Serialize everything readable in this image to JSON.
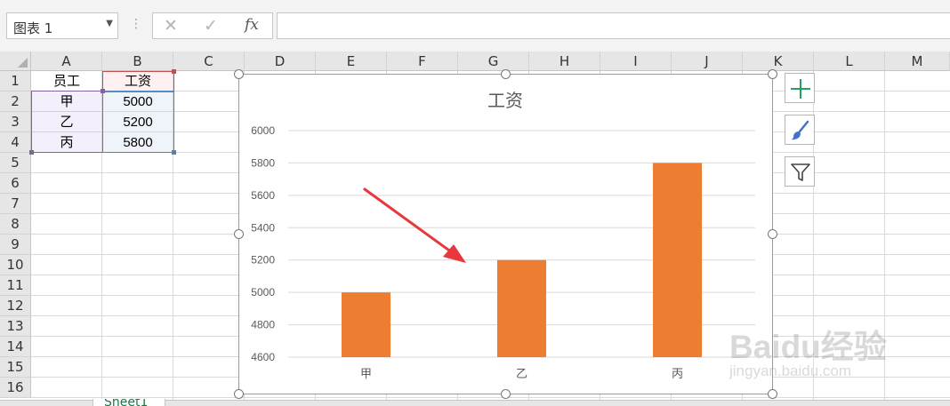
{
  "formula_bar": {
    "name_box": "图表 1",
    "cancel_icon": "✕",
    "enter_icon": "✓",
    "fx_label": "fx",
    "formula": ""
  },
  "columns": [
    "A",
    "B",
    "C",
    "D",
    "E",
    "F",
    "G",
    "H",
    "I",
    "J",
    "K",
    "L",
    "M"
  ],
  "rows": [
    "1",
    "2",
    "3",
    "4",
    "5",
    "6",
    "7",
    "8",
    "9",
    "10",
    "11",
    "12",
    "13",
    "14",
    "15",
    "16"
  ],
  "cells": {
    "A1": "员工",
    "B1": "工资",
    "A2": "甲",
    "B2": "5000",
    "A3": "乙",
    "B3": "5200",
    "A4": "丙",
    "B4": "5800"
  },
  "colors": {
    "accent": "#217346",
    "bar": "#ED7D31",
    "arrow": "#E8373D"
  },
  "chart_data": {
    "type": "bar",
    "title": "工资",
    "categories": [
      "甲",
      "乙",
      "丙"
    ],
    "values": [
      5000,
      5200,
      5800
    ],
    "ylim": [
      4600,
      6000
    ],
    "yticks": [
      "4600",
      "4800",
      "5000",
      "5200",
      "5400",
      "5600",
      "5800",
      "6000"
    ],
    "grid": true,
    "color": "#ED7D31"
  },
  "side_buttons": [
    "plus-icon",
    "brush-icon",
    "filter-icon"
  ],
  "sheet": {
    "tab": "Sheet1"
  },
  "watermark": {
    "logo": "Baidu经验",
    "sub": "jingyan.baidu.com"
  }
}
